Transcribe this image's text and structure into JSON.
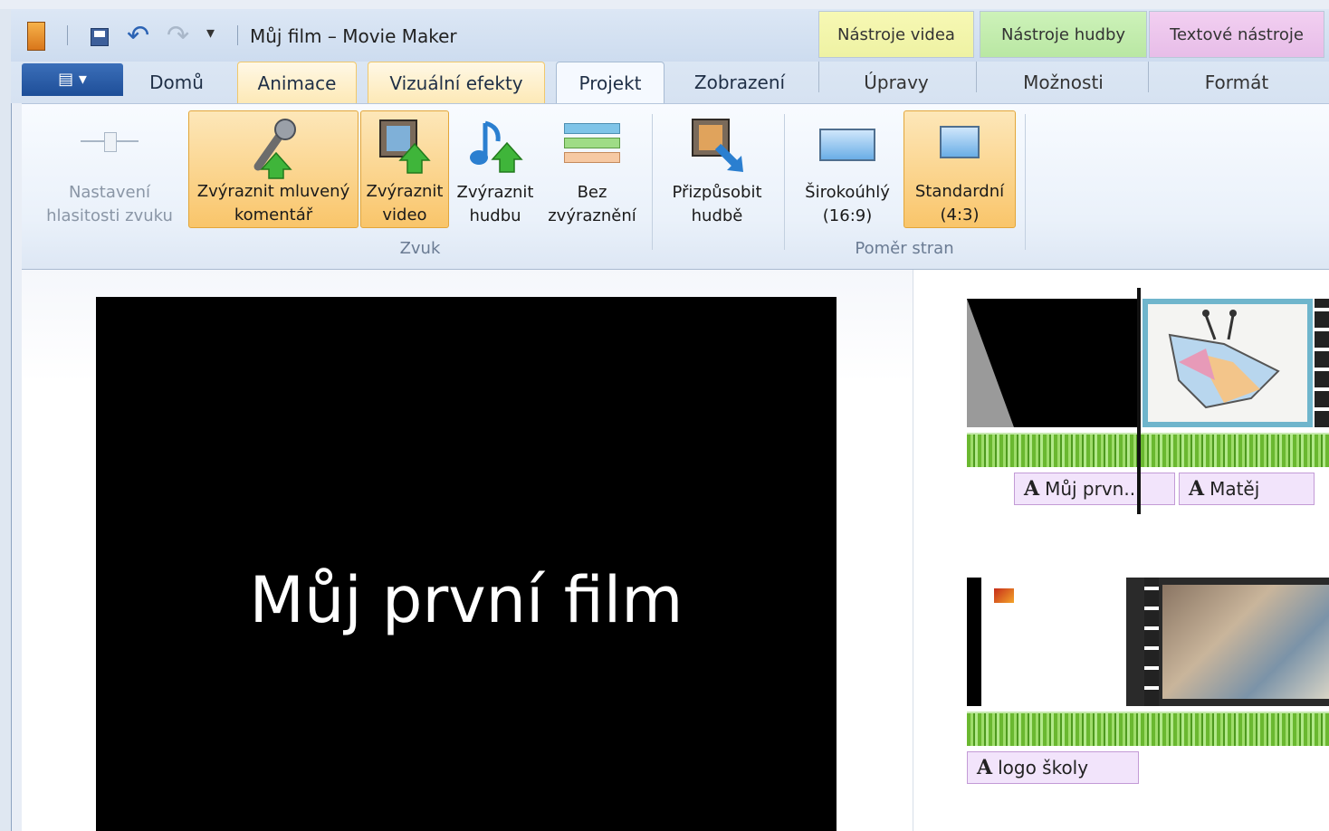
{
  "window": {
    "title": "Můj film – Movie Maker"
  },
  "context_headers": {
    "video": "Nástroje videa",
    "music": "Nástroje hudby",
    "text": "Textové nástroje"
  },
  "tabs": {
    "home": "Domů",
    "animations": "Animace",
    "visual_effects": "Vizuální efekty",
    "project": "Projekt",
    "view": "Zobrazení",
    "edit": "Úpravy",
    "options": "Možnosti",
    "format": "Formát"
  },
  "ribbon": {
    "volume": "Nastavení hlasitosti zvuku",
    "emph_narration": "Zvýraznit mluvený komentář",
    "emph_video": "Zvýraznit video",
    "emph_music": "Zvýraznit hudbu",
    "no_emph": "Bez zvýraznění",
    "fit_music": "Přizpůsobit hudbě",
    "widescreen": "Širokoúhlý (16:9)",
    "standard": "Standardní (4:3)",
    "group_audio": "Zvuk",
    "group_aspect": "Poměr stran"
  },
  "preview": {
    "text": "Můj první film"
  },
  "storyboard": {
    "caption1": "Můj prvn...",
    "caption2": "Matěj",
    "caption3": "logo školy",
    "caption_glyph": "A"
  },
  "colors": {
    "accent_blue": "#1e4e98",
    "highlight": "#f9c56a",
    "video_ctx": "#eef2a3",
    "music_ctx": "#b9e7a3",
    "text_ctx": "#e7bde8"
  }
}
